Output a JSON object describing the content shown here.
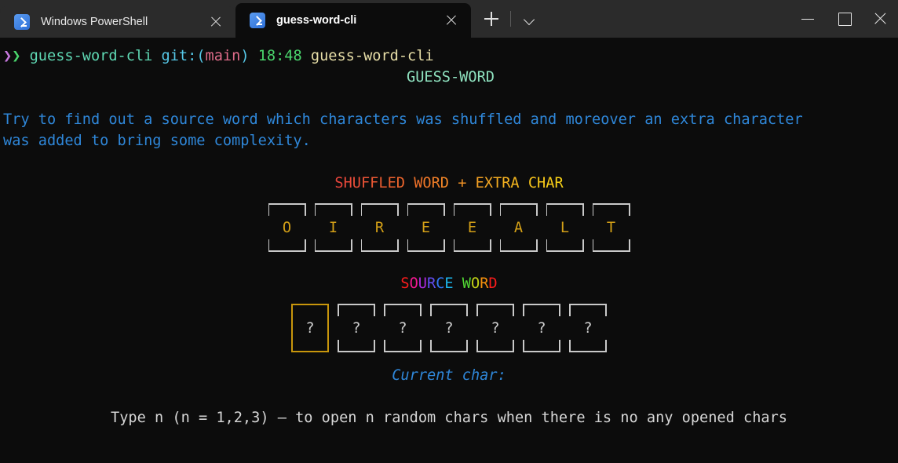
{
  "window": {
    "tabs": [
      {
        "title": "Windows PowerShell",
        "icon": "powershell-icon",
        "active": false
      },
      {
        "title": "guess-word-cli",
        "icon": "powershell-icon",
        "active": true
      }
    ],
    "new_tab_icon": "plus-icon",
    "dropdown_icon": "chevron-down-icon",
    "controls": {
      "minimize_icon": "minimize-icon",
      "maximize_icon": "maximize-icon",
      "close_icon": "close-icon"
    }
  },
  "terminal": {
    "prompt": {
      "chevron1": "❯",
      "chevron2": "❯",
      "directory": "guess-word-cli",
      "git_label": "git:(",
      "git_branch": "main",
      "git_close": ")",
      "time": "18:48",
      "command": "guess-word-cli"
    },
    "app_title": "GUESS-WORD",
    "description": "Try to find out a source word which characters was shuffled and moreover an extra character\nwas added to bring some complexity.",
    "shuffled_heading": "SHUFFLED WORD + EXTRA CHAR",
    "shuffled_letters": [
      "O",
      "I",
      "R",
      "E",
      "E",
      "A",
      "L",
      "T"
    ],
    "source_heading": "SOURCE WORD",
    "source_slots": [
      "?",
      "?",
      "?",
      "?",
      "?",
      "?",
      "?"
    ],
    "selected_slot_index": 0,
    "current_char_label": "Current char:",
    "current_char_value": "",
    "hint": "Type n (n = 1,2,3) — to open n random chars when there is no any opened chars"
  },
  "colors": {
    "background": "#0c0c0c",
    "titlebar": "#2b2b2b",
    "description": "#2f87d9",
    "app_title": "#8fe3c0",
    "letter": "#d4a017",
    "slot_border": "#c9c9c9",
    "slot_selected_border": "#c8960c",
    "hint_text": "#d6d6d6",
    "shuffled_heading_gradient": [
      "#e8453c",
      "#ef6c2a",
      "#f5a623",
      "#f7d117"
    ],
    "source_heading_gradient": [
      "#fb1c1c",
      "#f5179e",
      "#9b2ff0",
      "#4b5bf5",
      "#1f8bf5",
      "#18e3e3",
      "#27d63f",
      "#b6e01a",
      "#f59e0b",
      "#fb1c1c"
    ]
  }
}
